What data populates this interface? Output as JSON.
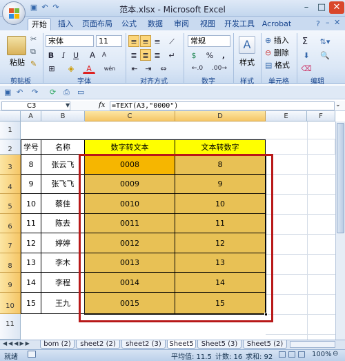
{
  "window": {
    "title": "范本.xlsx - Microsoft Excel"
  },
  "tabs": [
    "开始",
    "插入",
    "页面布局",
    "公式",
    "数据",
    "审阅",
    "视图",
    "开发工具",
    "Acrobat"
  ],
  "ribbon": {
    "clipboard": {
      "label": "剪贴板",
      "paste": "粘贴"
    },
    "font": {
      "label": "字体",
      "name": "宋体",
      "size": "11",
      "bold": "B",
      "italic": "I",
      "underline": "U",
      "grow": "A",
      "shrink": "A",
      "wen": "wén"
    },
    "alignment": {
      "label": "对齐方式"
    },
    "number": {
      "label": "数字",
      "format": "常规",
      "percent": "%",
      "comma": ",",
      "currency": "$"
    },
    "styles": {
      "label": "样式"
    },
    "cells": {
      "label": "单元格",
      "insert": "插入",
      "delete": "删除",
      "format": "格式"
    },
    "editing": {
      "label": "编辑",
      "sum": "Σ"
    }
  },
  "formula_bar": {
    "name_box": "C3",
    "fx": "fx",
    "formula": "=TEXT(A3,\"0000\")"
  },
  "columns": [
    "A",
    "B",
    "C",
    "D",
    "E",
    "F"
  ],
  "rows": [
    "1",
    "2",
    "3",
    "4",
    "5",
    "6",
    "7",
    "8",
    "9",
    "10",
    "11"
  ],
  "sheet": {
    "headers": {
      "a": "学号",
      "b": "名称",
      "c": "数字转文本",
      "d": "文本转数字"
    },
    "data": [
      {
        "a": "8",
        "b": "张云飞",
        "c": "0008",
        "d": "8"
      },
      {
        "a": "9",
        "b": "张飞飞",
        "c": "0009",
        "d": "9"
      },
      {
        "a": "10",
        "b": "蔡佳",
        "c": "0010",
        "d": "10"
      },
      {
        "a": "11",
        "b": "陈去",
        "c": "0011",
        "d": "11"
      },
      {
        "a": "12",
        "b": "婷婷",
        "c": "0012",
        "d": "12"
      },
      {
        "a": "13",
        "b": "李木",
        "c": "0013",
        "d": "13"
      },
      {
        "a": "14",
        "b": "李程",
        "c": "0014",
        "d": "14"
      },
      {
        "a": "15",
        "b": "王九",
        "c": "0015",
        "d": "15"
      }
    ]
  },
  "sheet_tabs": [
    "bom (2)",
    "sheet2 (2)",
    "sheet2 (3)",
    "Sheet5",
    "Sheet5 (3)",
    "Sheet5 (2)"
  ],
  "active_sheet": "Sheet5",
  "status": {
    "ready": "就绪",
    "average": "平均值: 11.5",
    "count": "计数: 16",
    "sum": "求和: 92",
    "zoom": "100%"
  },
  "colors": {
    "header_yellow": "#ffff00",
    "selection_fill": "#e8c155",
    "active_cell": "#f6b600",
    "highlight_box": "#b81919"
  }
}
